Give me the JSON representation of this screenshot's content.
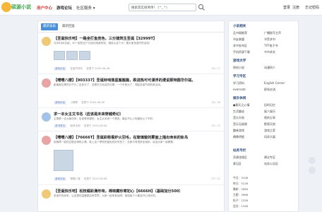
{
  "logo": {
    "text": "硕源小说"
  },
  "nav": {
    "items": [
      {
        "label": "用户中心"
      },
      {
        "label": "游戏论坛"
      },
      {
        "label": "社区服务 ▾"
      }
    ]
  },
  "search": {
    "value": "搜索其实很简单！ (^_^)"
  },
  "header_right": {
    "login": "登录",
    "register": "注册",
    "remember": "忘记密码"
  },
  "tabs": {
    "latest": "最新发表",
    "popular": "最新回复"
  },
  "posts": [
    {
      "title": "【圣诞快乐吧】一路坐打鱼竞色，三分建筑生圣诞【32999T】",
      "excerpt": "今天8月8日起，30一起的近个已经利用我的帖，相信从这个大！看大家圣诞节的活动！",
      "tag": "游戏分区",
      "author": "圣诞节快乐",
      "date": "发表于 2020-08-08",
      "stats": "16 / 17"
    },
    {
      "title": "【嘤嘤八楼】【903337】圣诞铃响落星搬搬篇，跌进热可可漂浮的漫说那特圆华尔兹。",
      "excerpt": "距离被拉黑的日子已二百多天了，这是外又改名的日期，一个东西为了，想起圣诞节前的新活动。",
      "tag": "游戏分区",
      "author": "小嗯嗯",
      "date": "发表于 2020-08-08",
      "stats": "28 / 36"
    },
    {
      "title": "求一本女主文书名（应该是未来穿越奇幻）",
      "excerpt": "主角是一名大魔法师，应该是来源的，女主从未说一个是真，最后不让人知道怎么了不好。",
      "tag": "求书求文",
      "author": "临风无雨",
      "date": "发表于 2020-08-08",
      "stats": "19 / 22"
    },
    {
      "title": "【嘤嘤八楼】【76666T】圣诞彩街看炉火羽毛，在玻璃窗的雾面上描出命目的轨鸟",
      "excerpt": "用钢琴一起的过程出海的心情，就上这个漂亮的蓝色的好东西了，在家中有很多圣诞树，欢迎大家一起看看。",
      "tag": "游戏分区",
      "author": "嘤嘤八楼",
      "date": "发表于 2020-08-08",
      "stats": "25 / 31"
    },
    {
      "title": "【圣诞快乐吧】松枝缀彩满年味，棉袜藏珍寄初心【6666H】（基础加分500）",
      "excerpt": "圣诞节的到来，让这里的温暖更加有意思，大家一起来参加吧！相信每个人都会开心快乐的。",
      "tag": "游戏分区",
      "author": "",
      "date": "",
      "stats": ""
    }
  ],
  "sidebar": {
    "sec1_title": "小说相关",
    "sec1_links": [
      "品书阁推荐",
      "广播剧写主声",
      "书友联盟",
      "书荒求书",
      "求书发布区",
      "TXT电子书",
      "手机资源下载",
      "书书求文"
    ],
    "sec2_title": "游戏文学",
    "sec2_links": [
      "原创小说",
      "动漫同人"
    ],
    "sec3_title": "学习专区",
    "sec3_links": [
      "学习资料",
      "English Corner",
      "evernote",
      "职场交流"
    ],
    "sec4_title": "娱乐休闲",
    "sec4_links": [
      "●聊天之心情",
      "旧时记忆",
      "生活趣谈",
      "娱八娱乐",
      "音乐天地",
      "视听分享",
      "音乐无极限",
      "影视天地",
      "趣味游戏",
      "游戏之家",
      "偶像明星",
      "风采大展"
    ],
    "sec5_title": "站务专栏",
    "sec5_links": [
      "资源违规区",
      "建议专区",
      "意见区",
      "站务公告区"
    ],
    "stats": [
      "今日：3108",
      "昨日：5126",
      "最新：2089",
      "主题：3968",
      "帖子：1326",
      "会员：1348"
    ]
  }
}
